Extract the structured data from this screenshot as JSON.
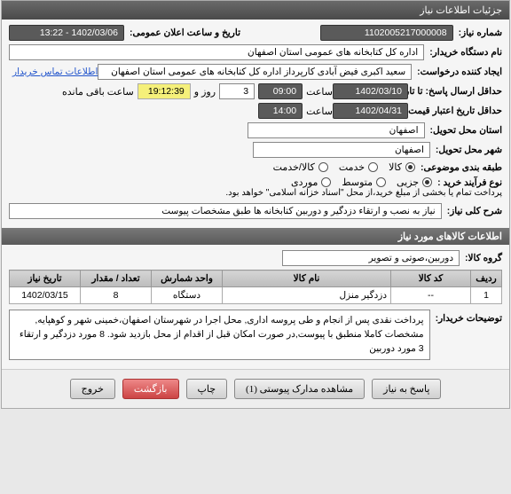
{
  "window_title": "جزئیات اطلاعات نیاز",
  "fields": {
    "request_no_label": "شماره نیاز:",
    "request_no": "1102005217000008",
    "announce_label": "تاریخ و ساعت اعلان عمومی:",
    "announce_value": "1402/03/06 - 13:22",
    "buyer_org_label": "نام دستگاه خریدار:",
    "buyer_org": "اداره کل کتابخانه های عمومی استان اصفهان",
    "creator_label": "ایجاد کننده درخواست:",
    "creator": "سعید اکبری فیض آبادی کارپرداز اداره کل کتابخانه های عمومی استان اصفهان",
    "contact_link": "اطلاعات تماس خریدار",
    "deadline_label": "حداقل ارسال پاسخ: تا تاریخ:",
    "deadline_date": "1402/03/10",
    "time_label1": "ساعت",
    "deadline_time": "09:00",
    "days_count": "3",
    "days_label": "روز و",
    "remain_time": "19:12:39",
    "remain_label": "ساعت باقی مانده",
    "validity_label": "حداقل تاریخ اعتبار قیمت: تا تاریخ:",
    "validity_date": "1402/04/31",
    "validity_time": "14:00",
    "province_label": "استان محل تحویل:",
    "province": "اصفهان",
    "city_label": "شهر محل تحویل:",
    "city": "اصفهان",
    "subject_cat_label": "طبقه بندی موضوعی:",
    "cat_goods": "کالا",
    "cat_service": "خدمت",
    "cat_goods_service": "کالا/خدمت",
    "purchase_type_label": "نوع فرآیند خرید :",
    "pt_partial": "جزیی",
    "pt_medium": "متوسط",
    "pt_moredi": "موردی",
    "payment_note": "پرداخت تمام یا بخشی از مبلغ خرید،از محل \"اسناد خزانه اسلامی\" خواهد بود.",
    "need_desc_label": "شرح کلی نیاز:",
    "need_desc": "نیاز به نصب و ارتقاء دزدگیر و دوربین کتابخانه ها طبق مشخصات پیوست",
    "goods_header": "اطلاعات کالاهای مورد نیاز",
    "goods_group_label": "گروه کالا:",
    "goods_group": "دوربین،صوتی و تصویر",
    "buyer_notes_label": "توضیحات خریدار:",
    "buyer_notes": "پرداخت نقدی پس از انجام و طی پروسه اداری, محل اجرا در شهرستان اصفهان،خمینی شهر و کوهپایه, مشخصات کاملا منطبق با پیوست,در صورت امکان قبل از اقدام از محل بازدید شود. 8 مورد دزدگیر و ارتقاء 3 مورد دوربین"
  },
  "table": {
    "headers": {
      "row": "ردیف",
      "code": "کد کالا",
      "name": "نام کالا",
      "unit": "واحد شمارش",
      "qty": "تعداد / مقدار",
      "date": "تاریخ نیاز"
    },
    "rows": [
      {
        "row": "1",
        "code": "--",
        "name": "دزدگیر منزل",
        "unit": "دستگاه",
        "qty": "8",
        "date": "1402/03/15"
      }
    ]
  },
  "buttons": {
    "respond": "پاسخ به نیاز",
    "attachments": "مشاهده مدارک پیوستی (1)",
    "print": "چاپ",
    "back": "بازگشت",
    "exit": "خروج"
  }
}
